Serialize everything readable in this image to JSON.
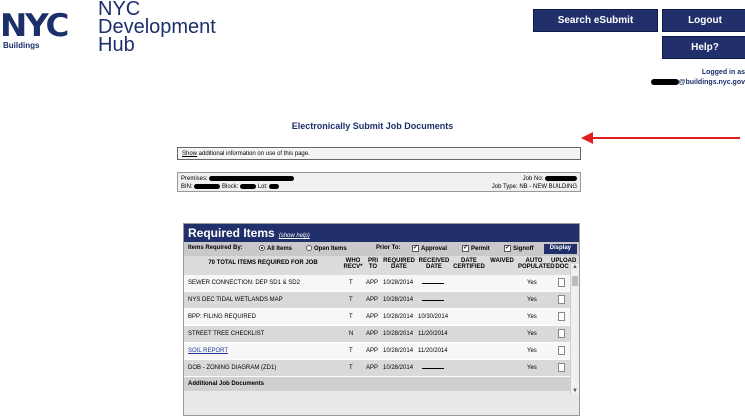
{
  "logo": {
    "mark": "NYC",
    "sub": "Buildings",
    "title_lines": [
      "NYC",
      "Development",
      "Hub"
    ]
  },
  "header_buttons": {
    "search": "Search eSubmit",
    "logout": "Logout",
    "help": "Help?"
  },
  "logged_in": {
    "line1": "Logged in as",
    "email_suffix": "@buildings.nyc.gov"
  },
  "page_title": "Electronically Submit Job Documents",
  "info": {
    "link": "Show",
    "text": " additional information on use of this page."
  },
  "premises": {
    "premises_label": "Premises:",
    "bin_label": "BIN:",
    "block_label": "Block:",
    "lot_label": "Lot:",
    "job_no_label": "Job No:",
    "job_type_label": "Job Type:",
    "job_type_value": "NB - NEW BUILDING"
  },
  "required": {
    "title": "Required Items",
    "help_link": "(show help)",
    "filter_label": "Items Required By:",
    "all_items": "All Items",
    "open_items": "Open Items",
    "prior_to": "Prior To:",
    "approval": "Approval",
    "permit": "Permit",
    "signoff": "Signoff",
    "display_btn": "Display",
    "columns": {
      "name": "70 TOTAL ITEMS REQUIRED FOR JOB",
      "who": "WHO RECV*",
      "pri": "PRI TO",
      "required": "REQUIRED DATE",
      "received": "RECEIVED DATE",
      "certified": "DATE CERTIFIED",
      "waived": "WAIVED",
      "auto": "AUTO POPULATED",
      "upload": "UPLOAD DOC"
    },
    "rows": [
      {
        "name": "SEWER CONNECTION: DEP SD1 & SD2",
        "who": "T",
        "pri": "APP",
        "required": "10/28/2014",
        "received": "",
        "auto": "Yes",
        "link": false
      },
      {
        "name": "NYS DEC TIDAL WETLANDS MAP",
        "who": "T",
        "pri": "APP",
        "required": "10/28/2014",
        "received": "",
        "auto": "Yes",
        "link": false
      },
      {
        "name": "BPP: FILING REQUIRED",
        "who": "T",
        "pri": "APP",
        "required": "10/28/2014",
        "received": "10/30/2014",
        "auto": "Yes",
        "link": false
      },
      {
        "name": "STREET TREE CHECKLIST",
        "who": "N",
        "pri": "APP",
        "required": "10/28/2014",
        "received": "11/20/2014",
        "auto": "Yes",
        "link": false
      },
      {
        "name": "SOIL REPORT",
        "who": "T",
        "pri": "APP",
        "required": "10/28/2014",
        "received": "11/20/2014",
        "auto": "Yes",
        "link": true
      },
      {
        "name": "DOB - ZONING DIAGRAM (ZD1)",
        "who": "T",
        "pri": "APP",
        "required": "10/28/2014",
        "received": "",
        "auto": "Yes",
        "link": false
      }
    ],
    "additional": "Additional Job Documents"
  }
}
